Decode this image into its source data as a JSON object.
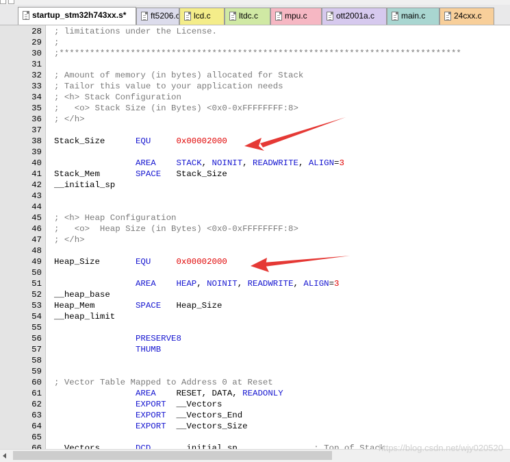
{
  "tabs": [
    {
      "label": "startup_stm32h743xx.s*",
      "color": "#ffffff",
      "active": true
    },
    {
      "label": "ft5206.c",
      "color": "#dcdcec",
      "active": false
    },
    {
      "label": "lcd.c",
      "color": "#f4ed8a",
      "active": false
    },
    {
      "label": "ltdc.c",
      "color": "#d0e9a4",
      "active": false
    },
    {
      "label": "mpu.c",
      "color": "#f6b7c3",
      "active": false
    },
    {
      "label": "ott2001a.c",
      "color": "#d6c9ee",
      "active": false
    },
    {
      "label": "main.c",
      "color": "#a9d6d1",
      "active": false
    },
    {
      "label": "24cxx.c",
      "color": "#f8cf9a",
      "active": false
    }
  ],
  "lines": [
    {
      "n": "28",
      "parts": [
        {
          "t": "; limitations under the License.",
          "c": "c"
        }
      ]
    },
    {
      "n": "29",
      "parts": [
        {
          "t": ";",
          "c": "c"
        }
      ]
    },
    {
      "n": "30",
      "parts": [
        {
          "t": ";*******************************************************************************",
          "c": "c"
        }
      ]
    },
    {
      "n": "31",
      "parts": []
    },
    {
      "n": "32",
      "parts": [
        {
          "t": "; Amount of memory (in bytes) allocated for Stack",
          "c": "c"
        }
      ]
    },
    {
      "n": "33",
      "parts": [
        {
          "t": "; Tailor this value to your application needs",
          "c": "c"
        }
      ]
    },
    {
      "n": "34",
      "parts": [
        {
          "t": "; <h> Stack Configuration",
          "c": "c"
        }
      ]
    },
    {
      "n": "35",
      "parts": [
        {
          "t": ";   <o> Stack Size (in Bytes) <0x0-0xFFFFFFFF:8>",
          "c": "c"
        }
      ]
    },
    {
      "n": "36",
      "parts": [
        {
          "t": "; </h>",
          "c": "c"
        }
      ]
    },
    {
      "n": "37",
      "parts": []
    },
    {
      "n": "38",
      "parts": [
        {
          "t": "Stack_Size      ",
          "c": "t"
        },
        {
          "t": "EQU",
          "c": "k"
        },
        {
          "t": "     ",
          "c": "t"
        },
        {
          "t": "0x00002000",
          "c": "n"
        }
      ]
    },
    {
      "n": "39",
      "parts": []
    },
    {
      "n": "40",
      "parts": [
        {
          "t": "                ",
          "c": "t"
        },
        {
          "t": "AREA",
          "c": "k"
        },
        {
          "t": "    ",
          "c": "t"
        },
        {
          "t": "STACK",
          "c": "k"
        },
        {
          "t": ", ",
          "c": "t"
        },
        {
          "t": "NOINIT",
          "c": "k"
        },
        {
          "t": ", ",
          "c": "t"
        },
        {
          "t": "READWRITE",
          "c": "k"
        },
        {
          "t": ", ",
          "c": "t"
        },
        {
          "t": "ALIGN",
          "c": "k"
        },
        {
          "t": "=",
          "c": "t"
        },
        {
          "t": "3",
          "c": "n"
        }
      ]
    },
    {
      "n": "41",
      "parts": [
        {
          "t": "Stack_Mem       ",
          "c": "t"
        },
        {
          "t": "SPACE",
          "c": "k"
        },
        {
          "t": "   Stack_Size",
          "c": "t"
        }
      ]
    },
    {
      "n": "42",
      "parts": [
        {
          "t": "__initial_sp",
          "c": "t"
        }
      ]
    },
    {
      "n": "43",
      "parts": []
    },
    {
      "n": "44",
      "parts": []
    },
    {
      "n": "45",
      "parts": [
        {
          "t": "; <h> Heap Configuration",
          "c": "c"
        }
      ]
    },
    {
      "n": "46",
      "parts": [
        {
          "t": ";   <o>  Heap Size (in Bytes) <0x0-0xFFFFFFFF:8>",
          "c": "c"
        }
      ]
    },
    {
      "n": "47",
      "parts": [
        {
          "t": "; </h>",
          "c": "c"
        }
      ]
    },
    {
      "n": "48",
      "parts": []
    },
    {
      "n": "49",
      "parts": [
        {
          "t": "Heap_Size       ",
          "c": "t"
        },
        {
          "t": "EQU",
          "c": "k"
        },
        {
          "t": "     ",
          "c": "t"
        },
        {
          "t": "0x00002000",
          "c": "n"
        }
      ]
    },
    {
      "n": "50",
      "parts": []
    },
    {
      "n": "51",
      "parts": [
        {
          "t": "                ",
          "c": "t"
        },
        {
          "t": "AREA",
          "c": "k"
        },
        {
          "t": "    ",
          "c": "t"
        },
        {
          "t": "HEAP",
          "c": "k"
        },
        {
          "t": ", ",
          "c": "t"
        },
        {
          "t": "NOINIT",
          "c": "k"
        },
        {
          "t": ", ",
          "c": "t"
        },
        {
          "t": "READWRITE",
          "c": "k"
        },
        {
          "t": ", ",
          "c": "t"
        },
        {
          "t": "ALIGN",
          "c": "k"
        },
        {
          "t": "=",
          "c": "t"
        },
        {
          "t": "3",
          "c": "n"
        }
      ]
    },
    {
      "n": "52",
      "parts": [
        {
          "t": "__heap_base",
          "c": "t"
        }
      ]
    },
    {
      "n": "53",
      "parts": [
        {
          "t": "Heap_Mem        ",
          "c": "t"
        },
        {
          "t": "SPACE",
          "c": "k"
        },
        {
          "t": "   Heap_Size",
          "c": "t"
        }
      ]
    },
    {
      "n": "54",
      "parts": [
        {
          "t": "__heap_limit",
          "c": "t"
        }
      ]
    },
    {
      "n": "55",
      "parts": []
    },
    {
      "n": "56",
      "parts": [
        {
          "t": "                ",
          "c": "t"
        },
        {
          "t": "PRESERVE8",
          "c": "k"
        }
      ]
    },
    {
      "n": "57",
      "parts": [
        {
          "t": "                ",
          "c": "t"
        },
        {
          "t": "THUMB",
          "c": "k"
        }
      ]
    },
    {
      "n": "58",
      "parts": []
    },
    {
      "n": "59",
      "parts": []
    },
    {
      "n": "60",
      "parts": [
        {
          "t": "; Vector Table Mapped to Address 0 at Reset",
          "c": "c"
        }
      ]
    },
    {
      "n": "61",
      "parts": [
        {
          "t": "                ",
          "c": "t"
        },
        {
          "t": "AREA",
          "c": "k"
        },
        {
          "t": "    RESET, DATA, ",
          "c": "t"
        },
        {
          "t": "READONLY",
          "c": "k"
        }
      ]
    },
    {
      "n": "62",
      "parts": [
        {
          "t": "                ",
          "c": "t"
        },
        {
          "t": "EXPORT",
          "c": "k"
        },
        {
          "t": "  __Vectors",
          "c": "t"
        }
      ]
    },
    {
      "n": "63",
      "parts": [
        {
          "t": "                ",
          "c": "t"
        },
        {
          "t": "EXPORT",
          "c": "k"
        },
        {
          "t": "  __Vectors_End",
          "c": "t"
        }
      ]
    },
    {
      "n": "64",
      "parts": [
        {
          "t": "                ",
          "c": "t"
        },
        {
          "t": "EXPORT",
          "c": "k"
        },
        {
          "t": "  __Vectors_Size",
          "c": "t"
        }
      ]
    },
    {
      "n": "65",
      "parts": []
    },
    {
      "n": "66",
      "parts": [
        {
          "t": "__Vectors       ",
          "c": "t"
        },
        {
          "t": "DCD",
          "c": "k"
        },
        {
          "t": "     __initial_sp               ",
          "c": "t"
        },
        {
          "t": "; Top of Stack",
          "c": "c"
        }
      ]
    }
  ],
  "annotation_color": "#e53935",
  "watermark": "https://blog.csdn.net/wjy020520"
}
